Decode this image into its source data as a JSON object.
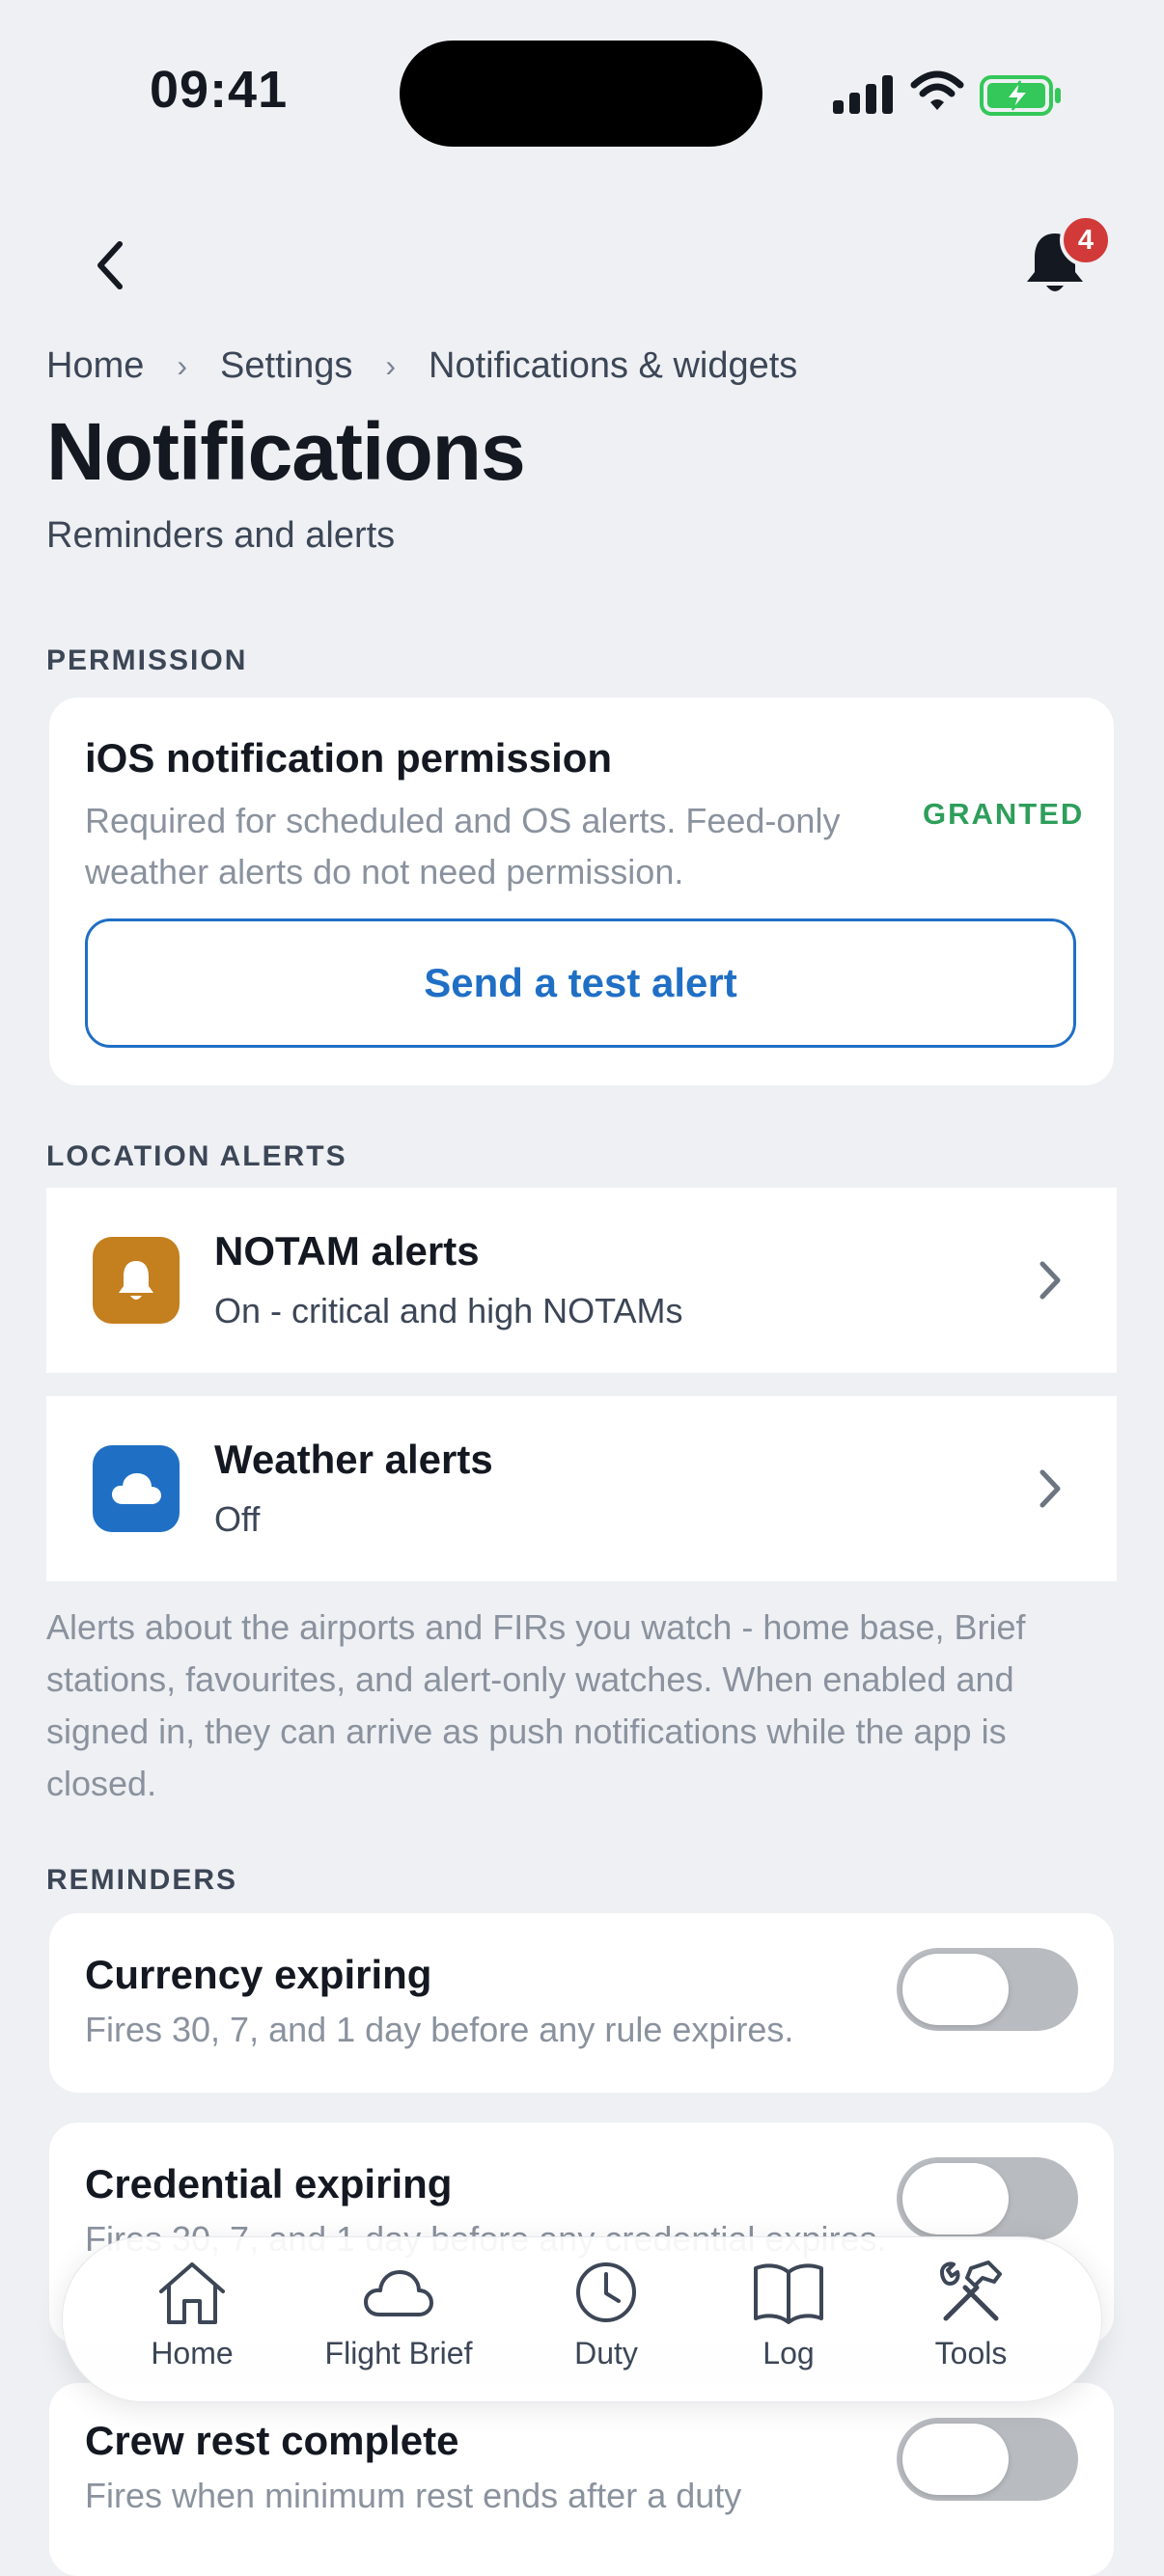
{
  "status_bar": {
    "time": "09:41"
  },
  "header": {
    "notification_count": "4"
  },
  "breadcrumb": [
    "Home",
    "Settings",
    "Notifications & widgets"
  ],
  "page": {
    "title": "Notifications",
    "subtitle": "Reminders and alerts"
  },
  "permission": {
    "section_label": "PERMISSION",
    "title": "iOS notification permission",
    "description": "Required for scheduled and OS alerts. Feed-only weather alerts do not need permission.",
    "status": "GRANTED",
    "test_button": "Send a test alert"
  },
  "location_alerts": {
    "section_label": "LOCATION ALERTS",
    "items": [
      {
        "title": "NOTAM alerts",
        "subtitle": "On - critical and high NOTAMs",
        "icon": "bell-icon",
        "color": "#c47f1e"
      },
      {
        "title": "Weather alerts",
        "subtitle": "Off",
        "icon": "cloud-icon",
        "color": "#1f6fc5"
      }
    ],
    "note": "Alerts about the airports and FIRs you watch - home base, Brief stations, favourites, and alert-only watches. When enabled and signed in, they can arrive as push notifications while the app is closed."
  },
  "reminders": {
    "section_label": "REMINDERS",
    "items": [
      {
        "title": "Currency expiring",
        "subtitle": "Fires 30, 7, and 1 day before any rule expires.",
        "enabled": false
      },
      {
        "title": "Credential expiring",
        "subtitle": "Fires 30, 7, and 1 day before any credential expires.",
        "enabled": false
      },
      {
        "title": "Crew rest complete",
        "subtitle": "Fires when minimum rest ends after a duty",
        "enabled": false
      }
    ]
  },
  "tab_bar": {
    "tabs": [
      {
        "label": "Home",
        "icon": "home-icon"
      },
      {
        "label": "Flight Brief",
        "icon": "cloud-icon"
      },
      {
        "label": "Duty",
        "icon": "clock-icon"
      },
      {
        "label": "Log",
        "icon": "book-icon"
      },
      {
        "label": "Tools",
        "icon": "tools-icon"
      }
    ]
  },
  "colors": {
    "accent": "#1f6fc5",
    "granted": "#2e9e5b",
    "badge": "#d23a3a"
  }
}
